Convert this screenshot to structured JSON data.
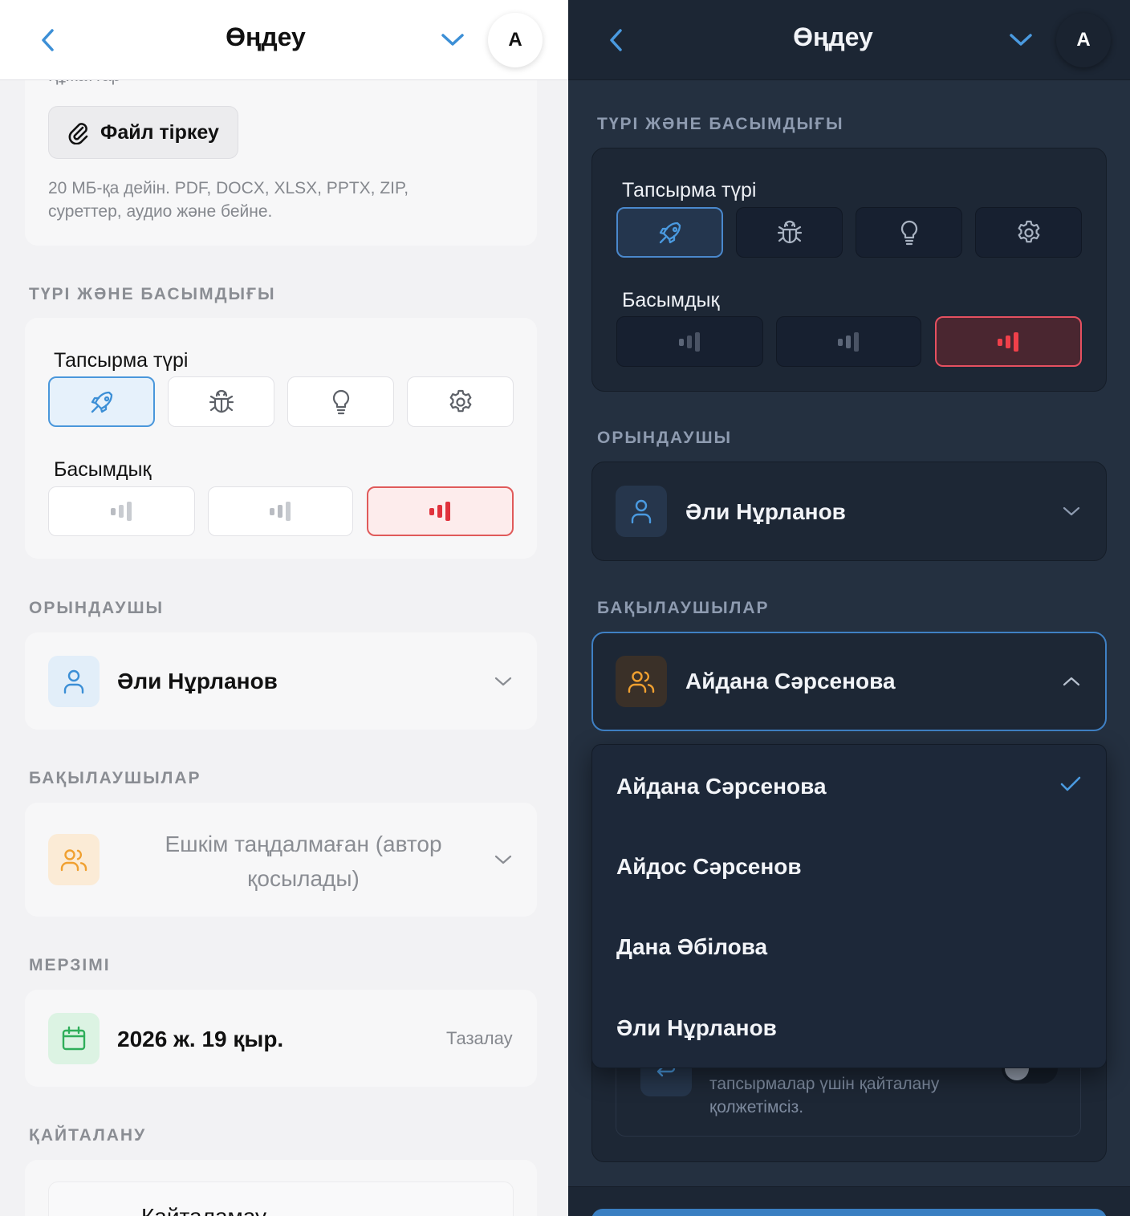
{
  "header": {
    "title": "Өңдеу",
    "avatar_letter": "A"
  },
  "attachments": {
    "cut_text": "Құжаттар",
    "file_button_label": "Файл тіркеу",
    "hint": "20 МБ-қа дейін. PDF, DOCX, XLSX, PPTX, ZIP, суреттер, аудио және бейне."
  },
  "type_priority": {
    "section_label": "ТҮРІ ЖӘНЕ БАСЫМДЫҒЫ",
    "task_type_label": "Тапсырма түрі",
    "task_types": [
      {
        "icon": "rocket-icon",
        "selected": true
      },
      {
        "icon": "bug-icon",
        "selected": false
      },
      {
        "icon": "lightbulb-icon",
        "selected": false
      },
      {
        "icon": "gear-icon",
        "selected": false
      }
    ],
    "priority_label": "Басымдық",
    "priorities": [
      {
        "icon": "priority-low-icon",
        "level": 1,
        "selected": false
      },
      {
        "icon": "priority-medium-icon",
        "level": 2,
        "selected": false
      },
      {
        "icon": "priority-high-icon",
        "level": 3,
        "selected": true
      }
    ]
  },
  "assignee": {
    "section_label": "ОРЫНДАУШЫ",
    "name": "Әли Нұрланов"
  },
  "observers": {
    "section_label": "БАҚЫЛАУШЫЛАР",
    "placeholder": "Ешкім таңдалмаған (автор қосылады)",
    "selected_name": "Айдана Сәрсенова",
    "options": [
      {
        "name": "Айдана Сәрсенова",
        "checked": true
      },
      {
        "name": "Айдос Сәрсенов",
        "checked": false
      },
      {
        "name": "Дана Әбілова",
        "checked": false
      },
      {
        "name": "Әли Нұрланов",
        "checked": false
      }
    ]
  },
  "deadline": {
    "section_label": "МЕРЗІМІ",
    "date": "2026 ж. 19 қыр.",
    "clear_label": "Тазалау"
  },
  "repeat": {
    "section_label": "ҚАЙТАЛАНУ",
    "option_label": "Қайталамау",
    "disabled_hint": "тапсырмалар үшін қайталану қолжетімсіз."
  },
  "colors": {
    "accent_blue": "#4a97db",
    "priority_red": "#e0323c",
    "observer_orange": "#f0a030",
    "deadline_green": "#2fae5a"
  }
}
